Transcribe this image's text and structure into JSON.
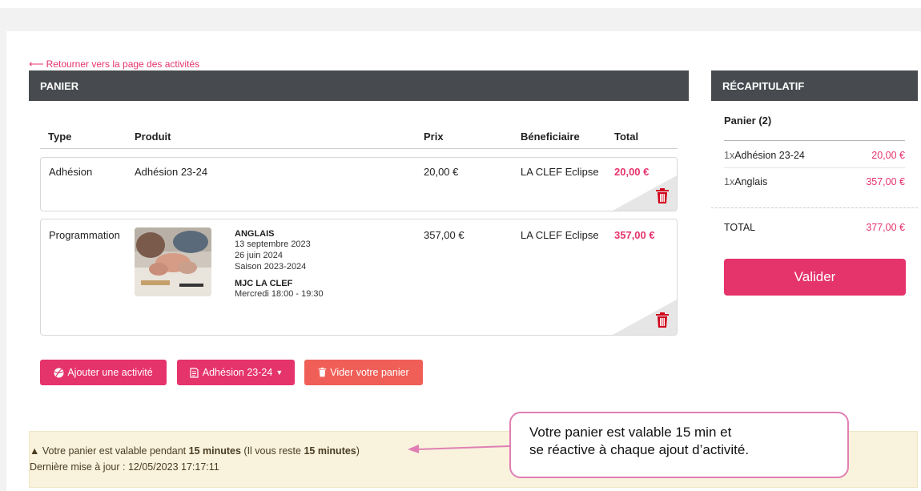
{
  "colors": {
    "accent": "#e5336c",
    "header_bg": "#474b4f",
    "danger": "#ef5f58",
    "alert_bg": "#f9f2dc",
    "callout_border": "#e07fb4"
  },
  "top": {
    "cut_text": "________"
  },
  "back_link": {
    "label": "Retourner vers la page des activités",
    "icon": "arrow-left-icon"
  },
  "panier": {
    "header": "PANIER",
    "columns": {
      "type": "Type",
      "produit": "Produit",
      "prix": "Prix",
      "beneficiaire": "Béneficiaire",
      "total": "Total"
    },
    "rows": [
      {
        "type": "Adhésion",
        "produit": "Adhésion 23-24",
        "prix": "20,00 €",
        "beneficiaire": "LA CLEF Eclipse",
        "total": "20,00 €"
      },
      {
        "type": "Programmation",
        "title": "ANGLAIS",
        "start": "13 septembre 2023",
        "end": "26 juin 2024",
        "season": "Saison 2023-2024",
        "place": "MJC LA CLEF",
        "schedule": "Mercredi 18:00 - 19:30",
        "prix": "357,00 €",
        "beneficiaire": "LA CLEF Eclipse",
        "total": "357,00 €"
      }
    ],
    "buttons": {
      "add": "Ajouter une activité",
      "adhesion": "Adhésion 23-24",
      "empty": "Vider votre panier"
    }
  },
  "recap": {
    "header": "RÉCAPITULATIF",
    "subtitle": "Panier (2)",
    "items": [
      {
        "qty": "1x",
        "name": "Adhésion 23-24",
        "amount": "20,00 €"
      },
      {
        "qty": "1x",
        "name": "Anglais",
        "amount": "357,00 €"
      }
    ],
    "total_label": "TOTAL",
    "total_amount": "377,00 €",
    "validate": "Valider"
  },
  "alert": {
    "pre": "Votre panier est valable pendant ",
    "dur1": "15 minutes",
    "mid": " (Il vous reste ",
    "dur2": "15 minutes",
    "post": ")",
    "updated": "Dernière mise à jour : 12/05/2023 17:17:11"
  },
  "callout": {
    "line1": "Votre panier est valable 15 min et",
    "line2": "se réactive à chaque ajout d’activité."
  }
}
